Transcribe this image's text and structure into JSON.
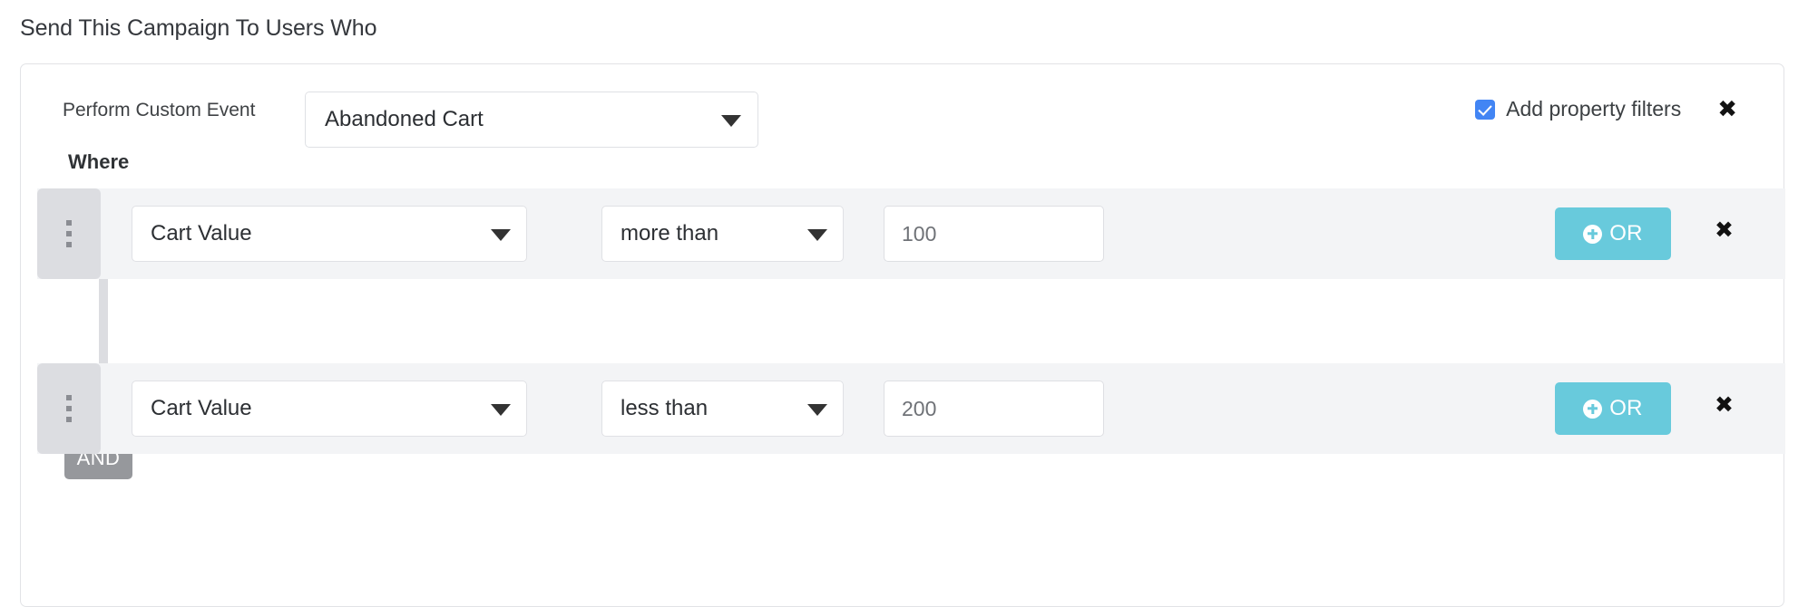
{
  "page_title": "Send This Campaign To Users Who",
  "event": {
    "label": "Perform Custom Event",
    "selected": "Abandoned Cart",
    "caret_icon": "chevron-down-icon",
    "filters_checkbox_checked": true,
    "filters_label": "Add property filters",
    "close_icon": "close-icon",
    "close_glyph": "✖"
  },
  "where_label": "Where",
  "logic_operator": "AND",
  "colors": {
    "accent_or_button": "#68cadc",
    "checkbox_blue": "#4285f4",
    "row_background": "#f3f4f6",
    "drag_handle": "#dcdde1",
    "and_badge": "#96989c",
    "card_border": "#e2e3e6"
  },
  "conditions": [
    {
      "drag_icon": "drag-handle-icon",
      "property": "Cart Value",
      "operator": "more than",
      "value": "100",
      "or_label": "OR",
      "or_icon": "plus-circle-icon",
      "close_icon": "close-icon",
      "close_glyph": "✖"
    },
    {
      "drag_icon": "drag-handle-icon",
      "property": "Cart Value",
      "operator": "less than",
      "value": "200",
      "or_label": "OR",
      "or_icon": "plus-circle-icon",
      "close_icon": "close-icon",
      "close_glyph": "✖"
    }
  ]
}
